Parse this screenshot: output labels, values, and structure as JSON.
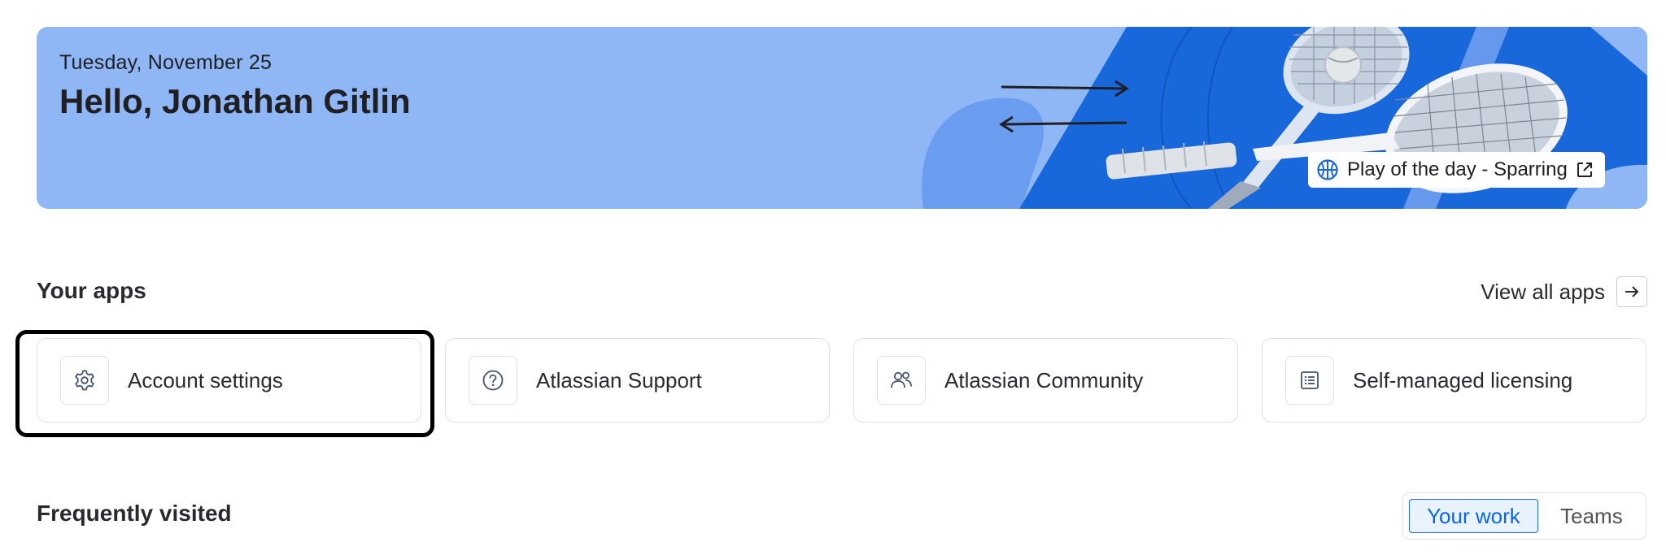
{
  "banner": {
    "date": "Tuesday, November 25",
    "greeting": "Hello, Jonathan Gitlin",
    "play_of_day": "Play of the day - Sparring",
    "play_icon": "basketball-icon",
    "external_icon": "external-link-icon"
  },
  "apps": {
    "title": "Your apps",
    "view_all": "View all apps",
    "items": [
      {
        "label": "Account settings",
        "icon": "gear-icon"
      },
      {
        "label": "Atlassian Support",
        "icon": "question-circle-icon"
      },
      {
        "label": "Atlassian Community",
        "icon": "people-icon"
      },
      {
        "label": "Self-managed licensing",
        "icon": "list-icon"
      }
    ]
  },
  "frequently_visited": {
    "title": "Frequently visited",
    "tabs": [
      {
        "label": "Your work",
        "selected": true
      },
      {
        "label": "Teams",
        "selected": false
      }
    ]
  },
  "colors": {
    "banner_bg": "#8fb6f5",
    "accent_blue": "#1868db",
    "focus_ring": "#000000"
  }
}
